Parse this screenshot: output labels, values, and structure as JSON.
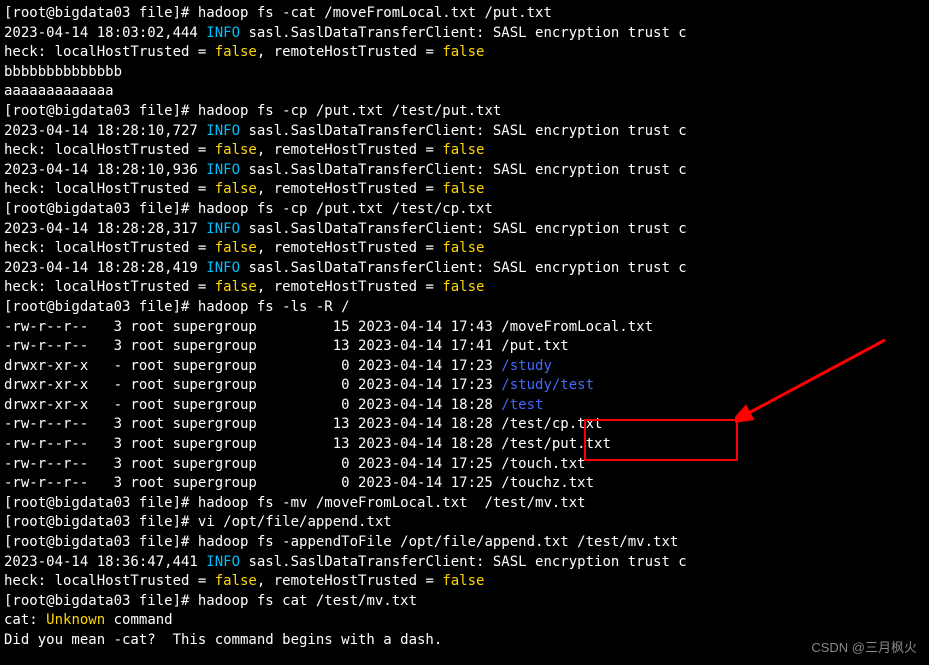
{
  "prompt": "[root@bigdata03 file]# ",
  "commands": {
    "cat1": "hadoop fs -cat /moveFromLocal.txt /put.txt",
    "cp1": "hadoop fs -cp /put.txt /test/put.txt",
    "cp2": "hadoop fs -cp /put.txt /test/cp.txt",
    "ls": "hadoop fs -ls -R /",
    "mv": "hadoop fs -mv /moveFromLocal.txt  /test/mv.txt",
    "vi": "vi /opt/file/append.txt",
    "append": "hadoop fs -appendToFile /opt/file/append.txt /test/mv.txt",
    "cat2": "hadoop fs cat /test/mv.txt"
  },
  "timestamps": {
    "t1": "2023-04-14 18:03:02,444 ",
    "t2": "2023-04-14 18:28:10,727 ",
    "t3": "2023-04-14 18:28:10,936 ",
    "t4": "2023-04-14 18:28:28,317 ",
    "t5": "2023-04-14 18:28:28,419 ",
    "t6": "2023-04-14 18:36:47,441 "
  },
  "info_tag": "INFO",
  "sasl_msg": " sasl.SaslDataTransferClient: SASL encryption trust c",
  "heck_prefix": "heck: localHostTrusted = ",
  "false_val": "false",
  "remote_mid": ", remoteHostTrusted = ",
  "output": {
    "bbbb": "bbbbbbbbbbbbbb",
    "aaaa": "aaaaaaaaaaaaa"
  },
  "ls_rows": [
    {
      "perm": "-rw-r--r--   3 root supergroup         15 2023-04-14 17:43 ",
      "path": "/moveFromLocal.txt"
    },
    {
      "perm": "-rw-r--r--   3 root supergroup         13 2023-04-14 17:41 ",
      "path": "/put.txt"
    },
    {
      "perm": "drwxr-xr-x   - root supergroup          0 2023-04-14 17:23 ",
      "path": "/study"
    },
    {
      "perm": "drwxr-xr-x   - root supergroup          0 2023-04-14 17:23 ",
      "path": "/study/test"
    },
    {
      "perm": "drwxr-xr-x   - root supergroup          0 2023-04-14 18:28 ",
      "path": "/test"
    },
    {
      "perm": "-rw-r--r--   3 root supergroup         13 2023-04-14 18:28 ",
      "path": "/test/cp.txt"
    },
    {
      "perm": "-rw-r--r--   3 root supergroup         13 2023-04-14 18:28 ",
      "path": "/test/put.txt"
    },
    {
      "perm": "-rw-r--r--   3 root supergroup          0 2023-04-14 17:25 ",
      "path": "/touch.txt"
    },
    {
      "perm": "-rw-r--r--   3 root supergroup          0 2023-04-14 17:25 ",
      "path": "/touchz.txt"
    }
  ],
  "cat_err": "cat: ",
  "unknown": "Unknown",
  "command_word": " command",
  "dash_msg": "Did you mean -cat?  This command begins with a dash.",
  "watermark": "CSDN @三月枫火"
}
